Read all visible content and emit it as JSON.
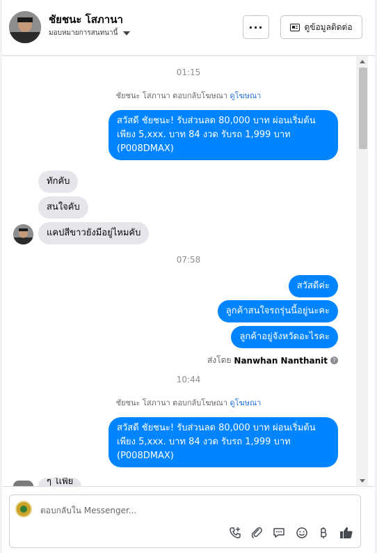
{
  "header": {
    "contact_name": "ชัยชนะ โสภานา",
    "assigned_label": "มอบหมายการสนทนานี้",
    "more_label": "···",
    "view_contact_label": "ดูข้อมูลติดต่อ"
  },
  "conversation": {
    "time_1": "01:15",
    "reply_note_1": {
      "text": "ชัยชนะ โสภานา ตอบกลับโฆษณา",
      "link": "ดูโฆษณา"
    },
    "ad_message_1": "สวัสดี ชัยชนะ! รับส่วนลด 80,000 บาท ผ่อนเริ่มต้นเพียง 5,xxx. บาท 84 งวด รับรถ 1,999 บาท (P008DMAX)",
    "incoming_1": "ทักคับ",
    "incoming_2": "สนใจคับ",
    "incoming_3": "แคปสีขาวยังมีอยู่ไหมคับ",
    "time_2": "07:58",
    "outgoing_1": "สวัสดีค่ะ",
    "outgoing_2": "ลูกค้าสนใจรถรุ่นนี้อยู่นะคะ",
    "outgoing_3": "ลูกค้าอยู่จังหวัดอะไรคะ",
    "sent_by": {
      "prefix": "ส่งโดย",
      "name": "Nanwhan Nanthanit"
    },
    "time_3": "10:44",
    "reply_note_2": {
      "text": "ชัยชนะ โสภานา ตอบกลับโฆษณา",
      "link": "ดูโฆษณา"
    },
    "ad_message_2": "สวัสดี ชัยชนะ! รับส่วนลด 80,000 บาท ผ่อนเริ่มต้นเพียง 5,xxx. บาท 84 งวด รับรถ 1,999 บาท (P008DMAX)",
    "incoming_partial": "ๆ ไเพีย"
  },
  "composer": {
    "placeholder": "ตอบกลับใน Messenger...",
    "icons": [
      "call-add-icon",
      "attachment-icon",
      "saved-reply-icon",
      "emoji-icon",
      "baht-icon",
      "thumbs-up-icon"
    ]
  },
  "colors": {
    "outgoing_bubble": "#0084ff",
    "incoming_bubble": "#e4e6eb",
    "link": "#216fdb"
  }
}
